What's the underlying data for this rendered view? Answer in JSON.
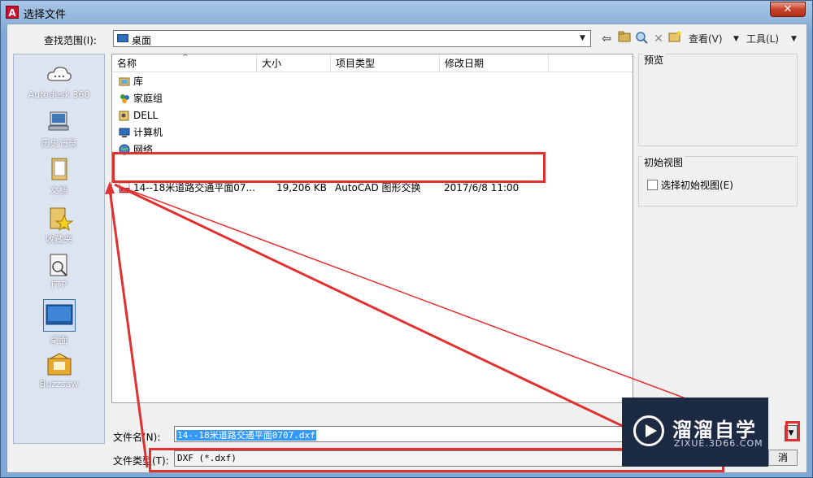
{
  "window": {
    "title": "选择文件",
    "close_label": "✕"
  },
  "lookin": {
    "label": "查找范围(I):",
    "value": "桌面"
  },
  "toolbar": {
    "view_label": "查看(V)",
    "tools_label": "工具(L)"
  },
  "places": [
    {
      "label": "Autodesk 360",
      "icon": "cloud-icon"
    },
    {
      "label": "历史记录",
      "icon": "history-icon"
    },
    {
      "label": "文档",
      "icon": "documents-icon"
    },
    {
      "label": "收藏夹",
      "icon": "favorites-icon"
    },
    {
      "label": "FTP",
      "icon": "ftp-icon"
    },
    {
      "label": "桌面",
      "icon": "desktop-icon"
    },
    {
      "label": "Buzzsaw",
      "icon": "buzzsaw-icon"
    }
  ],
  "columns": {
    "name": "名称",
    "size": "大小",
    "type": "项目类型",
    "date": "修改日期"
  },
  "files": [
    {
      "name": "库",
      "size": "",
      "type": "",
      "date": "",
      "icon": "library-icon"
    },
    {
      "name": "家庭组",
      "size": "",
      "type": "",
      "date": "",
      "icon": "homegroup-icon"
    },
    {
      "name": "DELL",
      "size": "",
      "type": "",
      "date": "",
      "icon": "user-folder-icon"
    },
    {
      "name": "计算机",
      "size": "",
      "type": "",
      "date": "",
      "icon": "computer-icon"
    },
    {
      "name": "网络",
      "size": "",
      "type": "",
      "date": "",
      "icon": "network-icon"
    },
    {
      "name": "14--18米道路交通平面07...",
      "size": "19,206 KB",
      "type": "AutoCAD 图形交换",
      "date": "2017/6/8 11:00",
      "icon": "dxf-file-icon"
    }
  ],
  "preview": {
    "title": "预览"
  },
  "initial_view": {
    "title": "初始视图",
    "checkbox_label": "选择初始视图(E)",
    "checked": false
  },
  "filename": {
    "label": "文件名(N):",
    "value": "14--18米道路交通平面0707.dxf"
  },
  "filetype": {
    "label": "文件类型(T):",
    "value": "DXF (*.dxf)"
  },
  "buttons": {
    "cancel_partial": "消",
    "open_partial": ")"
  },
  "watermark": {
    "title": "溜溜自学",
    "subtitle": "ZIXUE.3D66.COM"
  },
  "colors": {
    "annotation": "#e03030",
    "selection": "#3399ff",
    "titlebar": "#8db3dc"
  }
}
